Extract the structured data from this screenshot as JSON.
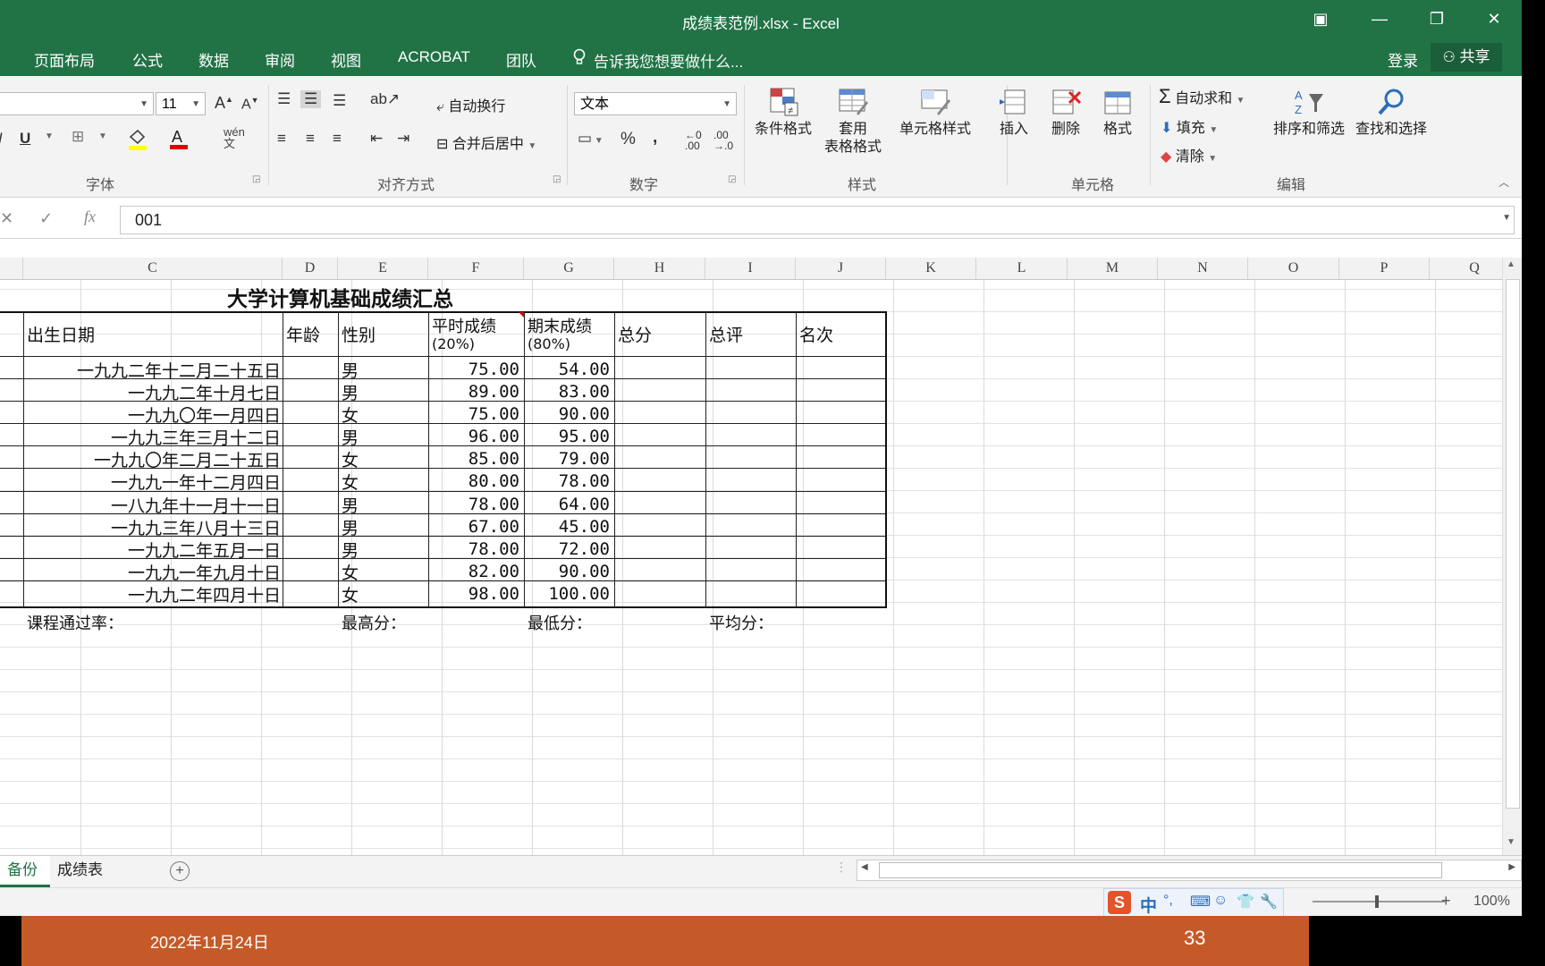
{
  "window": {
    "title": "成绩表范例.xlsx - Excel",
    "controls": {
      "restore_ribbon": "▣",
      "minimize": "—",
      "maximize": "❐",
      "close": "✕"
    }
  },
  "ribbon_tabs": [
    "页面布局",
    "公式",
    "数据",
    "审阅",
    "视图",
    "ACROBAT",
    "团队"
  ],
  "tell_me": "告诉我您想要做什么...",
  "login": "登录",
  "share": "共享",
  "ribbon": {
    "font_size": "11",
    "font_group_label": "字体",
    "align_group_label": "对齐方式",
    "wrap_text": "自动换行",
    "merge_center": "合并后居中",
    "number_format": "文本",
    "number_group_label": "数字",
    "percent": "%",
    "comma": ",",
    "cond_format": "条件格式",
    "format_table_l1": "套用",
    "format_table_l2": "表格格式",
    "cell_styles": "单元格样式",
    "styles_group_label": "样式",
    "insert": "插入",
    "delete": "删除",
    "format": "格式",
    "cells_group_label": "单元格",
    "autosum": "自动求和",
    "fill": "填充",
    "clear": "清除",
    "sort_filter": "排序和筛选",
    "find_select": "查找和选择",
    "editing_group_label": "编辑"
  },
  "formula_bar": {
    "value": "001",
    "fx": "fx"
  },
  "columns": [
    "C",
    "D",
    "E",
    "F",
    "G",
    "H",
    "I",
    "J",
    "K",
    "L",
    "M",
    "N",
    "O",
    "P",
    "Q"
  ],
  "sheet": {
    "title": "大学计算机基础成绩汇总",
    "headers": {
      "birth": "出生日期",
      "age": "年龄",
      "gender": "性别",
      "usual_l1": "平时成绩",
      "usual_l2": "(20%)",
      "final_l1": "期末成绩",
      "final_l2": "(80%)",
      "total": "总分",
      "evaluation": "总评",
      "rank": "名次"
    },
    "rows": [
      {
        "birth": "一九九二年十二月二十五日",
        "gender": "男",
        "usual": "75.00",
        "final": "54.00"
      },
      {
        "birth": "一九九二年十月七日",
        "gender": "男",
        "usual": "89.00",
        "final": "83.00"
      },
      {
        "birth": "一九九〇年一月四日",
        "gender": "女",
        "usual": "75.00",
        "final": "90.00"
      },
      {
        "birth": "一九九三年三月十二日",
        "gender": "男",
        "usual": "96.00",
        "final": "95.00"
      },
      {
        "birth": "一九九〇年二月二十五日",
        "gender": "女",
        "usual": "85.00",
        "final": "79.00"
      },
      {
        "birth": "一九九一年十二月四日",
        "gender": "女",
        "usual": "80.00",
        "final": "78.00"
      },
      {
        "birth": "一八九年十一月十一日",
        "gender": "男",
        "usual": "78.00",
        "final": "64.00"
      },
      {
        "birth": "一九九三年八月十三日",
        "gender": "男",
        "usual": "67.00",
        "final": "45.00"
      },
      {
        "birth": "一九九二年五月一日",
        "gender": "男",
        "usual": "78.00",
        "final": "72.00"
      },
      {
        "birth": "一九九一年九月十日",
        "gender": "女",
        "usual": "82.00",
        "final": "90.00"
      },
      {
        "birth": "一九九二年四月十日",
        "gender": "女",
        "usual": "98.00",
        "final": "100.00"
      }
    ],
    "summary": {
      "pass_rate": "课程通过率：",
      "max": "最高分：",
      "min": "最低分：",
      "avg": "平均分："
    }
  },
  "sheet_tabs": [
    {
      "label": "备份",
      "active": true
    },
    {
      "label": "成绩表",
      "active": false
    }
  ],
  "status": {
    "zoom": "100%",
    "ime": "中"
  },
  "footer": {
    "date": "2022年11月24日",
    "page": "33"
  },
  "colors": {
    "excel_green": "#217346",
    "footer_orange": "#c55a28"
  }
}
